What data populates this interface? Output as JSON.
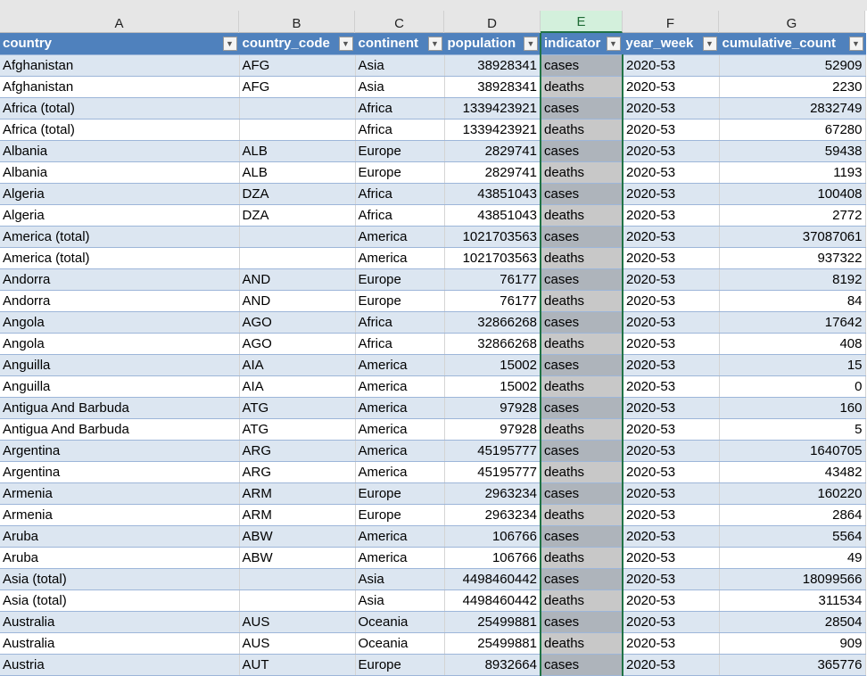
{
  "columns": [
    "A",
    "B",
    "C",
    "D",
    "E",
    "F",
    "G"
  ],
  "headers": [
    "country",
    "country_code",
    "continent",
    "population",
    "indicator",
    "year_week",
    "cumulative_count"
  ],
  "rows": [
    [
      "Afghanistan",
      "AFG",
      "Asia",
      "38928341",
      "cases",
      "2020-53",
      "52909"
    ],
    [
      "Afghanistan",
      "AFG",
      "Asia",
      "38928341",
      "deaths",
      "2020-53",
      "2230"
    ],
    [
      "Africa (total)",
      "",
      "Africa",
      "1339423921",
      "cases",
      "2020-53",
      "2832749"
    ],
    [
      "Africa (total)",
      "",
      "Africa",
      "1339423921",
      "deaths",
      "2020-53",
      "67280"
    ],
    [
      "Albania",
      "ALB",
      "Europe",
      "2829741",
      "cases",
      "2020-53",
      "59438"
    ],
    [
      "Albania",
      "ALB",
      "Europe",
      "2829741",
      "deaths",
      "2020-53",
      "1193"
    ],
    [
      "Algeria",
      "DZA",
      "Africa",
      "43851043",
      "cases",
      "2020-53",
      "100408"
    ],
    [
      "Algeria",
      "DZA",
      "Africa",
      "43851043",
      "deaths",
      "2020-53",
      "2772"
    ],
    [
      "America (total)",
      "",
      "America",
      "1021703563",
      "cases",
      "2020-53",
      "37087061"
    ],
    [
      "America (total)",
      "",
      "America",
      "1021703563",
      "deaths",
      "2020-53",
      "937322"
    ],
    [
      "Andorra",
      "AND",
      "Europe",
      "76177",
      "cases",
      "2020-53",
      "8192"
    ],
    [
      "Andorra",
      "AND",
      "Europe",
      "76177",
      "deaths",
      "2020-53",
      "84"
    ],
    [
      "Angola",
      "AGO",
      "Africa",
      "32866268",
      "cases",
      "2020-53",
      "17642"
    ],
    [
      "Angola",
      "AGO",
      "Africa",
      "32866268",
      "deaths",
      "2020-53",
      "408"
    ],
    [
      "Anguilla",
      "AIA",
      "America",
      "15002",
      "cases",
      "2020-53",
      "15"
    ],
    [
      "Anguilla",
      "AIA",
      "America",
      "15002",
      "deaths",
      "2020-53",
      "0"
    ],
    [
      "Antigua And Barbuda",
      "ATG",
      "America",
      "97928",
      "cases",
      "2020-53",
      "160"
    ],
    [
      "Antigua And Barbuda",
      "ATG",
      "America",
      "97928",
      "deaths",
      "2020-53",
      "5"
    ],
    [
      "Argentina",
      "ARG",
      "America",
      "45195777",
      "cases",
      "2020-53",
      "1640705"
    ],
    [
      "Argentina",
      "ARG",
      "America",
      "45195777",
      "deaths",
      "2020-53",
      "43482"
    ],
    [
      "Armenia",
      "ARM",
      "Europe",
      "2963234",
      "cases",
      "2020-53",
      "160220"
    ],
    [
      "Armenia",
      "ARM",
      "Europe",
      "2963234",
      "deaths",
      "2020-53",
      "2864"
    ],
    [
      "Aruba",
      "ABW",
      "America",
      "106766",
      "cases",
      "2020-53",
      "5564"
    ],
    [
      "Aruba",
      "ABW",
      "America",
      "106766",
      "deaths",
      "2020-53",
      "49"
    ],
    [
      "Asia (total)",
      "",
      "Asia",
      "4498460442",
      "cases",
      "2020-53",
      "18099566"
    ],
    [
      "Asia (total)",
      "",
      "Asia",
      "4498460442",
      "deaths",
      "2020-53",
      "311534"
    ],
    [
      "Australia",
      "AUS",
      "Oceania",
      "25499881",
      "cases",
      "2020-53",
      "28504"
    ],
    [
      "Australia",
      "AUS",
      "Oceania",
      "25499881",
      "deaths",
      "2020-53",
      "909"
    ],
    [
      "Austria",
      "AUT",
      "Europe",
      "8932664",
      "cases",
      "2020-53",
      "365776"
    ]
  ]
}
